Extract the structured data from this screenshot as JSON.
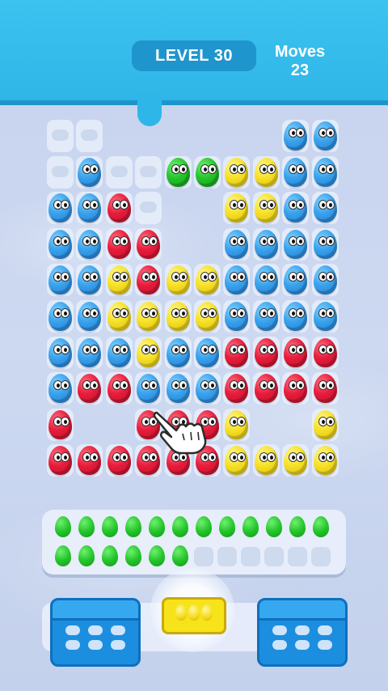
{
  "header": {
    "level_label": "LEVEL 30",
    "moves_label": "Moves",
    "moves_value": "23"
  },
  "colors": {
    "blue": "#3aa2ec",
    "red": "#e81c3c",
    "yellow": "#f7e127",
    "green": "#25c52c",
    "header": "#2fb6e8"
  },
  "board": {
    "columns": 10,
    "rows": [
      [
        "slot",
        "slot",
        null,
        null,
        null,
        null,
        null,
        null,
        "blue",
        "blue"
      ],
      [
        "slot",
        "blue",
        "slot",
        "slot",
        "green",
        "green",
        "yellow",
        "yellow",
        "blue",
        "blue"
      ],
      [
        "blue",
        "blue",
        "red",
        "slot",
        null,
        null,
        "yellow",
        "yellow",
        "blue",
        "blue"
      ],
      [
        "blue",
        "blue",
        "red",
        "red",
        null,
        null,
        "blue",
        "blue",
        "blue",
        "blue"
      ],
      [
        "blue",
        "blue",
        "yellow",
        "red",
        "yellow",
        "yellow",
        "blue",
        "blue",
        "blue",
        "blue"
      ],
      [
        "blue",
        "blue",
        "yellow",
        "yellow",
        "yellow",
        "yellow",
        "blue",
        "blue",
        "blue",
        "blue"
      ],
      [
        "blue",
        "blue",
        "blue",
        "yellow",
        "blue",
        "blue",
        "red",
        "red",
        "red",
        "red"
      ],
      [
        "blue",
        "red",
        "red",
        "blue",
        "blue",
        "blue",
        "red",
        "red",
        "red",
        "red"
      ],
      [
        "red",
        null,
        null,
        "red",
        "red",
        "red",
        "yellow",
        null,
        null,
        "yellow"
      ],
      [
        "red",
        "red",
        "red",
        "red",
        "red",
        "red",
        "yellow",
        "yellow",
        "yellow",
        "yellow"
      ]
    ]
  },
  "collector": {
    "top_row_filled": 12,
    "bottom_row_filled": 6,
    "slots_per_row": 12,
    "egg_color": "green"
  },
  "boxes": [
    {
      "name": "left-box",
      "color": "blue",
      "open": true
    },
    {
      "name": "center-box",
      "color": "yellow",
      "eggs": 3,
      "highlighted": true
    },
    {
      "name": "right-box",
      "color": "blue",
      "open": true
    }
  ],
  "icons": {
    "hand": "pointing-hand-icon"
  }
}
